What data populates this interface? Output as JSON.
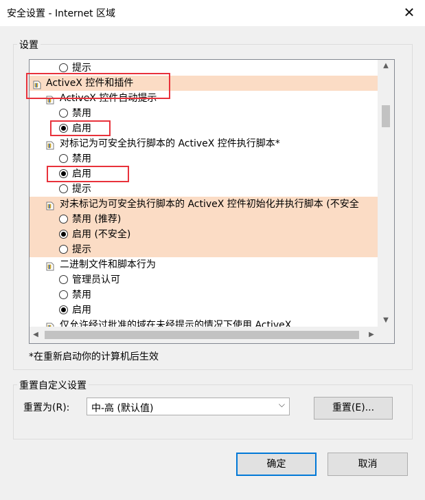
{
  "window": {
    "title": "安全设置 - Internet 区域",
    "close_glyph": "✕"
  },
  "settings": {
    "group_label": "设置",
    "rows": [
      {
        "kind": "radio",
        "label": "提示",
        "checked": false,
        "highlight": false
      },
      {
        "kind": "header",
        "label": "ActiveX 控件和插件",
        "highlight": true
      },
      {
        "kind": "item",
        "label": "ActiveX 控件自动提示",
        "highlight": false
      },
      {
        "kind": "radio",
        "label": "禁用",
        "checked": false,
        "highlight": false
      },
      {
        "kind": "radio",
        "label": "启用",
        "checked": true,
        "highlight": false
      },
      {
        "kind": "item",
        "label": "对标记为可安全执行脚本的 ActiveX 控件执行脚本*",
        "highlight": false
      },
      {
        "kind": "radio",
        "label": "禁用",
        "checked": false,
        "highlight": false
      },
      {
        "kind": "radio",
        "label": "启用",
        "checked": true,
        "highlight": false
      },
      {
        "kind": "radio",
        "label": "提示",
        "checked": false,
        "highlight": false
      },
      {
        "kind": "item",
        "label": "对未标记为可安全执行脚本的 ActiveX 控件初始化并执行脚本 (不安全",
        "highlight": true
      },
      {
        "kind": "radio",
        "label": "禁用 (推荐)",
        "checked": false,
        "highlight": true
      },
      {
        "kind": "radio",
        "label": "启用 (不安全)",
        "checked": true,
        "highlight": true
      },
      {
        "kind": "radio",
        "label": "提示",
        "checked": false,
        "highlight": true
      },
      {
        "kind": "item",
        "label": "二进制文件和脚本行为",
        "highlight": false
      },
      {
        "kind": "radio",
        "label": "管理员认可",
        "checked": false,
        "highlight": false
      },
      {
        "kind": "radio",
        "label": "禁用",
        "checked": false,
        "highlight": false
      },
      {
        "kind": "radio",
        "label": "启用",
        "checked": true,
        "highlight": false
      },
      {
        "kind": "item",
        "label": "仅允许经过批准的域在未经提示的情况下使用 ActiveX",
        "highlight": false
      }
    ],
    "note": "*在重新启动你的计算机后生效"
  },
  "reset": {
    "group_label": "重置自定义设置",
    "label": "重置为(R):",
    "selected": "中-高 (默认值)",
    "button": "重置(E)..."
  },
  "buttons": {
    "ok": "确定",
    "cancel": "取消"
  },
  "colors": {
    "highlight": "#fbdcc5",
    "annotation_red": "#e8313a",
    "focus_blue": "#0078d7"
  }
}
